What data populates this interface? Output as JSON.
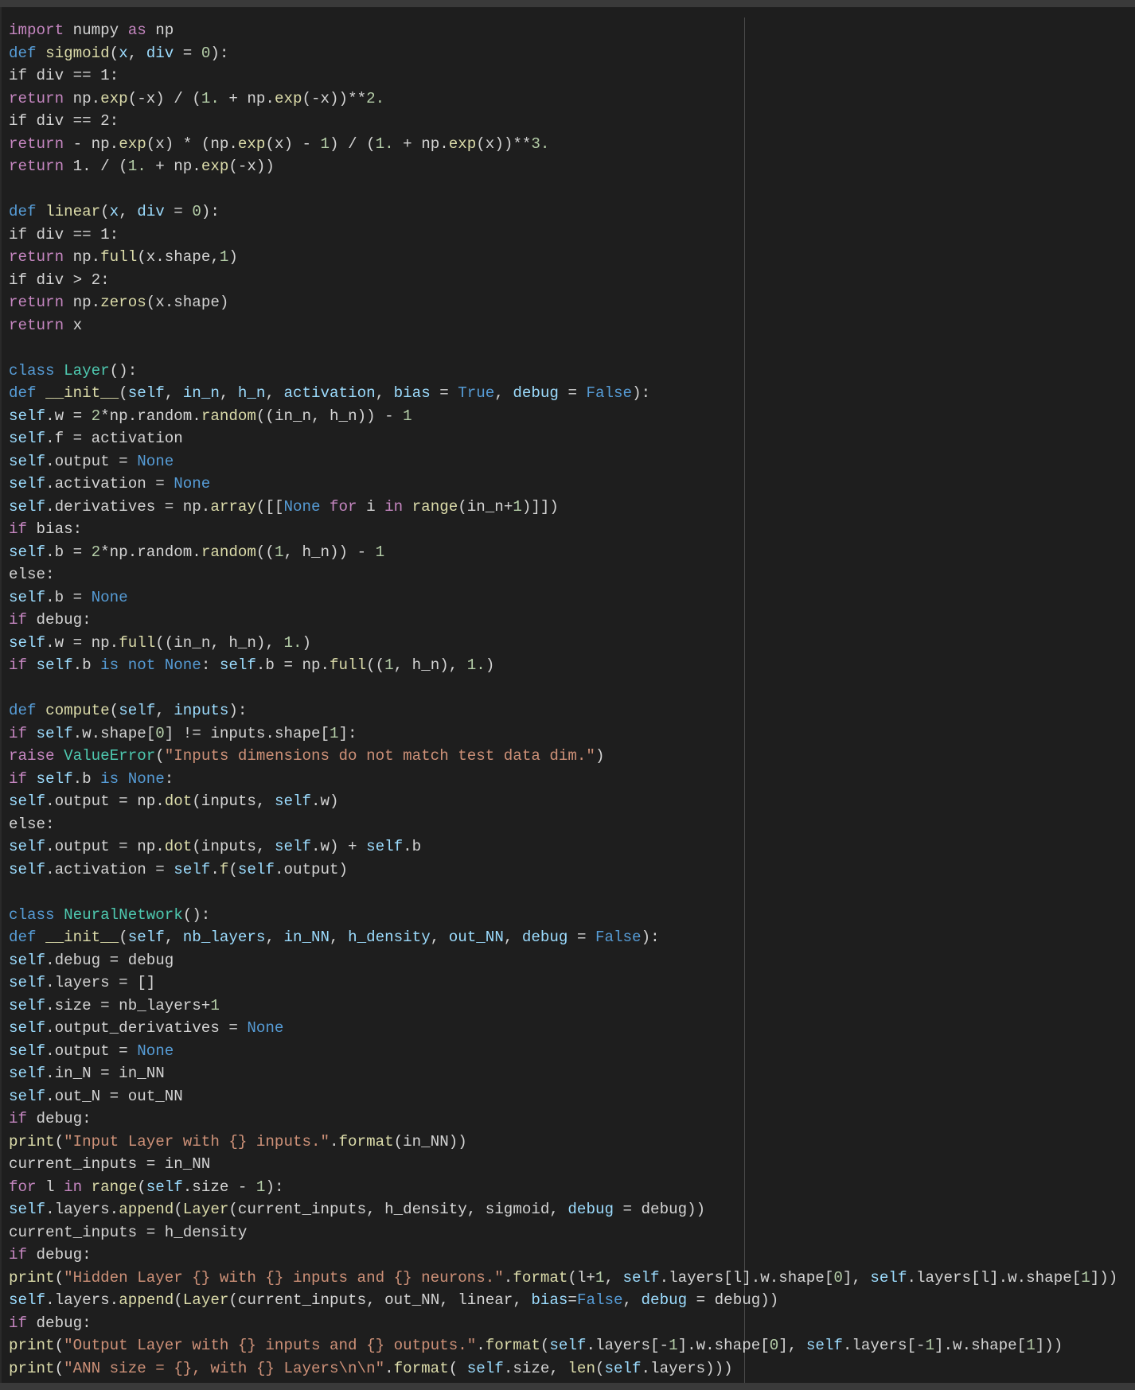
{
  "colors": {
    "background": "#1e1e1e",
    "keyword": "#c586c0",
    "storage": "#569cd6",
    "function": "#dcdcaa",
    "class": "#4ec9b0",
    "variable": "#9cdcfe",
    "number": "#b5cea8",
    "string": "#ce9178",
    "text": "#d4d4d4"
  },
  "code": {
    "lines": [
      "import numpy as np",
      "def sigmoid(x, div = 0):",
      "if div == 1:",
      "return np.exp(-x) / (1. + np.exp(-x))**2.",
      "if div == 2:",
      "return - np.exp(x) * (np.exp(x) - 1) / (1. + np.exp(x))**3.",
      "return 1. / (1. + np.exp(-x))",
      "",
      "def linear(x, div = 0):",
      "if div == 1:",
      "return np.full(x.shape,1)",
      "if div > 2:",
      "return np.zeros(x.shape)",
      "return x",
      "",
      "class Layer():",
      "def __init__(self, in_n, h_n, activation, bias = True, debug = False):",
      "self.w = 2*np.random.random((in_n, h_n)) - 1",
      "self.f = activation",
      "self.output = None",
      "self.activation = None",
      "self.derivatives = np.array([[None for i in range(in_n+1)]])",
      "if bias:",
      "self.b = 2*np.random.random((1, h_n)) - 1",
      "else:",
      "self.b = None",
      "if debug:",
      "self.w = np.full((in_n, h_n), 1.)",
      "if self.b is not None: self.b = np.full((1, h_n), 1.)",
      "",
      "def compute(self, inputs):",
      "if self.w.shape[0] != inputs.shape[1]:",
      "raise ValueError(\"Inputs dimensions do not match test data dim.\")",
      "if self.b is None:",
      "self.output = np.dot(inputs, self.w)",
      "else:",
      "self.output = np.dot(inputs, self.w) + self.b",
      "self.activation = self.f(self.output)",
      "",
      "class NeuralNetwork():",
      "def __init__(self, nb_layers, in_NN, h_density, out_NN, debug = False):",
      "self.debug = debug",
      "self.layers = []",
      "self.size = nb_layers+1",
      "self.output_derivatives = None",
      "self.output = None",
      "self.in_N = in_NN",
      "self.out_N = out_NN",
      "if debug:",
      "print(\"Input Layer with {} inputs.\".format(in_NN))",
      "current_inputs = in_NN",
      "for l in range(self.size - 1):",
      "self.layers.append(Layer(current_inputs, h_density, sigmoid, debug = debug))",
      "current_inputs = h_density",
      "if debug:",
      "print(\"Hidden Layer {} with {} inputs and {} neurons.\".format(l+1, self.layers[l].w.shape[0], self.layers[l].w.shape[1]))",
      "self.layers.append(Layer(current_inputs, out_NN, linear, bias=False, debug = debug))",
      "if debug:",
      "print(\"Output Layer with {} inputs and {} outputs.\".format(self.layers[-1].w.shape[0], self.layers[-1].w.shape[1]))",
      "print(\"ANN size = {}, with {} Layers\\n\\n\".format( self.size, len(self.layers)))"
    ]
  }
}
